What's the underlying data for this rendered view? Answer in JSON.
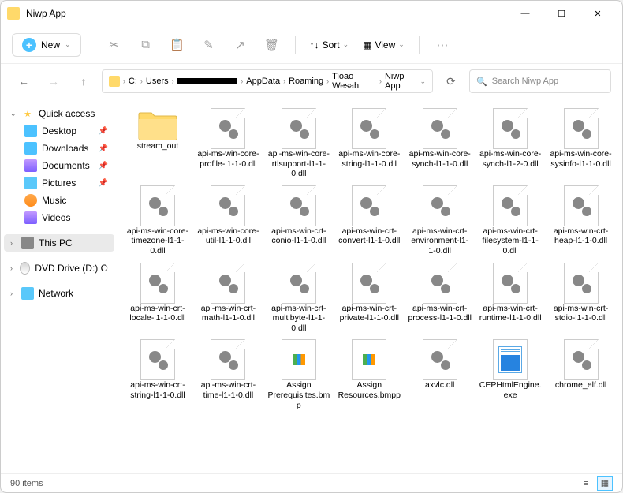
{
  "window": {
    "title": "Niwp App"
  },
  "toolbar": {
    "new_label": "New",
    "sort_label": "Sort",
    "view_label": "View"
  },
  "address": {
    "segments": [
      "C:",
      "Users",
      null,
      "AppData",
      "Roaming",
      "Tioao Wesah",
      "Niwp App"
    ]
  },
  "search": {
    "placeholder": "Search Niwp App"
  },
  "sidebar": {
    "quick_access": "Quick access",
    "items": [
      {
        "label": "Desktop",
        "icon": "blue",
        "pinned": true
      },
      {
        "label": "Downloads",
        "icon": "blue",
        "pinned": true
      },
      {
        "label": "Documents",
        "icon": "purple",
        "pinned": true
      },
      {
        "label": "Pictures",
        "icon": "teal",
        "pinned": true
      },
      {
        "label": "Music",
        "icon": "orange",
        "pinned": false
      },
      {
        "label": "Videos",
        "icon": "purple",
        "pinned": false
      }
    ],
    "this_pc": "This PC",
    "dvd": "DVD Drive (D:) CCCC",
    "network": "Network"
  },
  "files": {
    "items": [
      {
        "name": "stream_out",
        "type": "folder"
      },
      {
        "name": "api-ms-win-core-profile-l1-1-0.dll",
        "type": "dll"
      },
      {
        "name": "api-ms-win-core-rtlsupport-l1-1-0.dll",
        "type": "dll"
      },
      {
        "name": "api-ms-win-core-string-l1-1-0.dll",
        "type": "dll"
      },
      {
        "name": "api-ms-win-core-synch-l1-1-0.dll",
        "type": "dll"
      },
      {
        "name": "api-ms-win-core-synch-l1-2-0.dll",
        "type": "dll"
      },
      {
        "name": "api-ms-win-core-sysinfo-l1-1-0.dll",
        "type": "dll"
      },
      {
        "name": "api-ms-win-core-timezone-l1-1-0.dll",
        "type": "dll"
      },
      {
        "name": "api-ms-win-core-util-l1-1-0.dll",
        "type": "dll"
      },
      {
        "name": "api-ms-win-crt-conio-l1-1-0.dll",
        "type": "dll"
      },
      {
        "name": "api-ms-win-crt-convert-l1-1-0.dll",
        "type": "dll"
      },
      {
        "name": "api-ms-win-crt-environment-l1-1-0.dll",
        "type": "dll"
      },
      {
        "name": "api-ms-win-crt-filesystem-l1-1-0.dll",
        "type": "dll"
      },
      {
        "name": "api-ms-win-crt-heap-l1-1-0.dll",
        "type": "dll"
      },
      {
        "name": "api-ms-win-crt-locale-l1-1-0.dll",
        "type": "dll"
      },
      {
        "name": "api-ms-win-crt-math-l1-1-0.dll",
        "type": "dll"
      },
      {
        "name": "api-ms-win-crt-multibyte-l1-1-0.dll",
        "type": "dll"
      },
      {
        "name": "api-ms-win-crt-private-l1-1-0.dll",
        "type": "dll"
      },
      {
        "name": "api-ms-win-crt-process-l1-1-0.dll",
        "type": "dll"
      },
      {
        "name": "api-ms-win-crt-runtime-l1-1-0.dll",
        "type": "dll"
      },
      {
        "name": "api-ms-win-crt-stdio-l1-1-0.dll",
        "type": "dll"
      },
      {
        "name": "api-ms-win-crt-string-l1-1-0.dll",
        "type": "dll"
      },
      {
        "name": "api-ms-win-crt-time-l1-1-0.dll",
        "type": "dll"
      },
      {
        "name": "Assign Prerequisites.bmp",
        "type": "bmp"
      },
      {
        "name": "Assign Resources.bmpp",
        "type": "bmp"
      },
      {
        "name": "axvlc.dll",
        "type": "dll"
      },
      {
        "name": "CEPHtmlEngine.exe",
        "type": "exe"
      },
      {
        "name": "chrome_elf.dll",
        "type": "dll"
      }
    ]
  },
  "status": {
    "count": "90 items"
  }
}
